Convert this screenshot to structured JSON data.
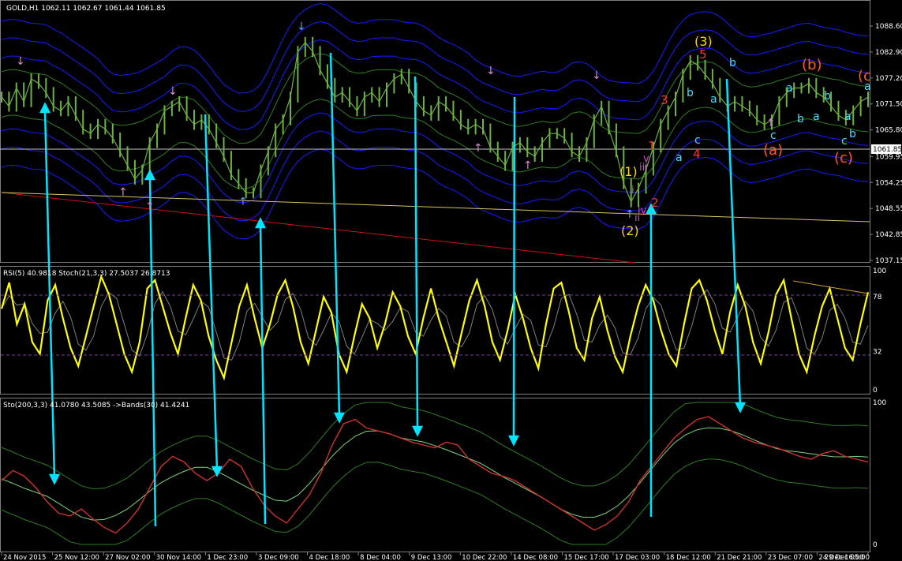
{
  "header": {
    "main": "GOLD,H1  1062.11 1062.67 1061.44 1061.85",
    "rsi": "RSI(5) 40.9818  Stoch(21,3,3) 27.5037 26.8713",
    "sto": "Sto(200,3,3) 41.0780 43.5085  ->Bands(30) 41.4241"
  },
  "colors": {
    "background": "#000000",
    "price": "#6db33f",
    "bands_blue": "#1a1aff",
    "bands_green": "#2e7d1e",
    "rsi": "#ffff00",
    "stoch": "#808080",
    "arrows": "#00e5ff",
    "trend_red": "#cc1111",
    "trend_yellow": "#d4c36a",
    "price_line": "#c0c0c0"
  },
  "chart_data": [
    {
      "type": "line",
      "title": "GOLD,H1",
      "y_ticks": [
        "1088.60",
        "1082.90",
        "1077.20",
        "1071.50",
        "1065.80",
        "1059.95",
        "1054.25",
        "1048.55",
        "1042.85",
        "1037.15"
      ],
      "current_price": "1061.85",
      "x_labels": [
        "24 Nov 2015",
        "25 Nov 12:00",
        "27 Nov 02:00",
        "30 Nov 14:00",
        "1 Dec 23:00",
        "3 Dec 09:00",
        "4 Dec 18:00",
        "8 Dec 04:00",
        "9 Dec 13:00",
        "10 Dec 22:00",
        "14 Dec 08:00",
        "15 Dec 17:00",
        "17 Dec 03:00",
        "18 Dec 12:00",
        "21 Dec 21:00",
        "23 Dec 07:00",
        "24 Dec 16:00",
        "29 Dec 05:00"
      ],
      "series": [
        {
          "values": [
            1073,
            1071,
            1075,
            1072,
            1077,
            1076,
            1074,
            1071,
            1070,
            1072,
            1069,
            1066,
            1065,
            1067,
            1066,
            1064,
            1061,
            1058,
            1055,
            1057,
            1063,
            1066,
            1070,
            1071,
            1072,
            1069,
            1067,
            1068,
            1066,
            1063,
            1060,
            1056,
            1054,
            1052,
            1052,
            1057,
            1061,
            1066,
            1068,
            1073,
            1083,
            1085,
            1083,
            1079,
            1076,
            1073,
            1074,
            1072,
            1070,
            1073,
            1074,
            1072,
            1075,
            1077,
            1078,
            1075,
            1072,
            1070,
            1069,
            1072,
            1071,
            1069,
            1067,
            1066,
            1067,
            1066,
            1062,
            1060,
            1058,
            1062,
            1063,
            1061,
            1060,
            1063,
            1065,
            1065,
            1064,
            1061,
            1060,
            1063,
            1068,
            1071,
            1066,
            1061,
            1054,
            1050,
            1053,
            1057,
            1062,
            1067,
            1070,
            1073,
            1078,
            1081,
            1080,
            1078,
            1076,
            1073,
            1071,
            1072,
            1071,
            1070,
            1068,
            1067,
            1068,
            1072,
            1074,
            1075,
            1075,
            1076,
            1074,
            1073,
            1071,
            1069,
            1068,
            1070,
            1072,
            1073
          ]
        }
      ]
    },
    {
      "type": "line",
      "title": "RSI(5) / Stoch(21,3,3)",
      "y_ticks": [
        "100",
        "78",
        "32",
        "0"
      ],
      "series": [
        {
          "values": [
            68,
            90,
            55,
            72,
            40,
            30,
            75,
            88,
            60,
            35,
            20,
            45,
            70,
            95,
            80,
            55,
            30,
            15,
            40,
            85,
            92,
            70,
            48,
            30,
            60,
            88,
            75,
            45,
            25,
            10,
            40,
            70,
            88,
            60,
            35,
            55,
            80,
            92,
            70,
            40,
            22,
            50,
            78,
            65,
            30,
            15,
            45,
            72,
            60,
            35,
            55,
            82,
            70,
            45,
            30,
            60,
            85,
            60,
            40,
            20,
            48,
            75,
            92,
            70,
            40,
            25,
            50,
            80,
            60,
            35,
            18,
            55,
            85,
            90,
            65,
            35,
            25,
            60,
            78,
            50,
            28,
            15,
            45,
            70,
            88,
            75,
            50,
            30,
            20,
            55,
            85,
            92,
            75,
            50,
            30,
            65,
            88,
            70,
            40,
            22,
            48,
            80,
            92,
            60,
            30,
            15,
            45,
            70,
            85,
            60,
            35,
            25,
            55,
            82
          ]
        }
      ]
    },
    {
      "type": "line",
      "title": "Sto(200,3,3) ->Bands(30)",
      "y_ticks": [
        "100",
        "0"
      ],
      "series": [
        {
          "values": [
            45,
            52,
            48,
            40,
            30,
            22,
            20,
            25,
            18,
            12,
            8,
            15,
            25,
            40,
            55,
            62,
            58,
            50,
            45,
            50,
            60,
            55,
            40,
            28,
            20,
            15,
            25,
            35,
            50,
            70,
            85,
            88,
            82,
            80,
            78,
            75,
            72,
            70,
            68,
            72,
            70,
            60,
            55,
            50,
            48,
            45,
            40,
            35,
            30,
            25,
            20,
            15,
            10,
            14,
            20,
            30,
            45,
            55,
            65,
            75,
            82,
            88,
            90,
            85,
            80,
            75,
            72,
            70,
            68,
            65,
            62,
            60,
            64,
            66,
            62,
            60,
            58
          ]
        }
      ]
    }
  ],
  "wave_labels": {
    "red": [
      "1",
      "2",
      "3",
      "4",
      "5",
      "(a)",
      "(b)",
      "(c)",
      "(c"
    ],
    "yellow": [
      "(1)",
      "(2)",
      "(3)"
    ],
    "magenta": [
      "i",
      "ii",
      "iii",
      "iv",
      "v"
    ],
    "cyan": [
      "a",
      "b",
      "c"
    ]
  }
}
